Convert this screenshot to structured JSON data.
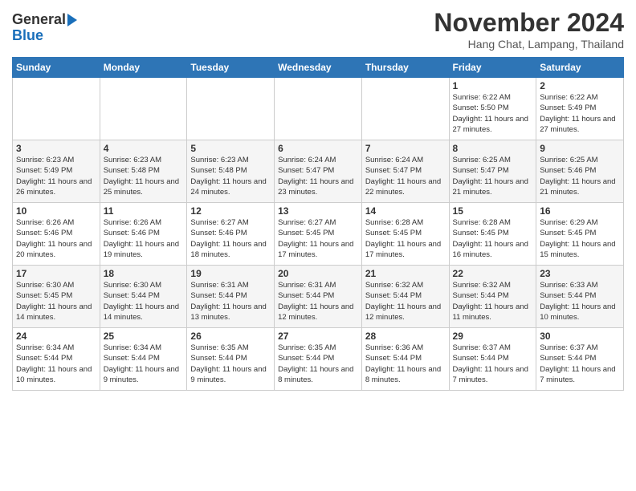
{
  "header": {
    "logo_general": "General",
    "logo_blue": "Blue",
    "title": "November 2024",
    "location": "Hang Chat, Lampang, Thailand"
  },
  "weekdays": [
    "Sunday",
    "Monday",
    "Tuesday",
    "Wednesday",
    "Thursday",
    "Friday",
    "Saturday"
  ],
  "weeks": [
    [
      {
        "day": "",
        "info": ""
      },
      {
        "day": "",
        "info": ""
      },
      {
        "day": "",
        "info": ""
      },
      {
        "day": "",
        "info": ""
      },
      {
        "day": "",
        "info": ""
      },
      {
        "day": "1",
        "info": "Sunrise: 6:22 AM\nSunset: 5:50 PM\nDaylight: 11 hours and 27 minutes."
      },
      {
        "day": "2",
        "info": "Sunrise: 6:22 AM\nSunset: 5:49 PM\nDaylight: 11 hours and 27 minutes."
      }
    ],
    [
      {
        "day": "3",
        "info": "Sunrise: 6:23 AM\nSunset: 5:49 PM\nDaylight: 11 hours and 26 minutes."
      },
      {
        "day": "4",
        "info": "Sunrise: 6:23 AM\nSunset: 5:48 PM\nDaylight: 11 hours and 25 minutes."
      },
      {
        "day": "5",
        "info": "Sunrise: 6:23 AM\nSunset: 5:48 PM\nDaylight: 11 hours and 24 minutes."
      },
      {
        "day": "6",
        "info": "Sunrise: 6:24 AM\nSunset: 5:47 PM\nDaylight: 11 hours and 23 minutes."
      },
      {
        "day": "7",
        "info": "Sunrise: 6:24 AM\nSunset: 5:47 PM\nDaylight: 11 hours and 22 minutes."
      },
      {
        "day": "8",
        "info": "Sunrise: 6:25 AM\nSunset: 5:47 PM\nDaylight: 11 hours and 21 minutes."
      },
      {
        "day": "9",
        "info": "Sunrise: 6:25 AM\nSunset: 5:46 PM\nDaylight: 11 hours and 21 minutes."
      }
    ],
    [
      {
        "day": "10",
        "info": "Sunrise: 6:26 AM\nSunset: 5:46 PM\nDaylight: 11 hours and 20 minutes."
      },
      {
        "day": "11",
        "info": "Sunrise: 6:26 AM\nSunset: 5:46 PM\nDaylight: 11 hours and 19 minutes."
      },
      {
        "day": "12",
        "info": "Sunrise: 6:27 AM\nSunset: 5:46 PM\nDaylight: 11 hours and 18 minutes."
      },
      {
        "day": "13",
        "info": "Sunrise: 6:27 AM\nSunset: 5:45 PM\nDaylight: 11 hours and 17 minutes."
      },
      {
        "day": "14",
        "info": "Sunrise: 6:28 AM\nSunset: 5:45 PM\nDaylight: 11 hours and 17 minutes."
      },
      {
        "day": "15",
        "info": "Sunrise: 6:28 AM\nSunset: 5:45 PM\nDaylight: 11 hours and 16 minutes."
      },
      {
        "day": "16",
        "info": "Sunrise: 6:29 AM\nSunset: 5:45 PM\nDaylight: 11 hours and 15 minutes."
      }
    ],
    [
      {
        "day": "17",
        "info": "Sunrise: 6:30 AM\nSunset: 5:45 PM\nDaylight: 11 hours and 14 minutes."
      },
      {
        "day": "18",
        "info": "Sunrise: 6:30 AM\nSunset: 5:44 PM\nDaylight: 11 hours and 14 minutes."
      },
      {
        "day": "19",
        "info": "Sunrise: 6:31 AM\nSunset: 5:44 PM\nDaylight: 11 hours and 13 minutes."
      },
      {
        "day": "20",
        "info": "Sunrise: 6:31 AM\nSunset: 5:44 PM\nDaylight: 11 hours and 12 minutes."
      },
      {
        "day": "21",
        "info": "Sunrise: 6:32 AM\nSunset: 5:44 PM\nDaylight: 11 hours and 12 minutes."
      },
      {
        "day": "22",
        "info": "Sunrise: 6:32 AM\nSunset: 5:44 PM\nDaylight: 11 hours and 11 minutes."
      },
      {
        "day": "23",
        "info": "Sunrise: 6:33 AM\nSunset: 5:44 PM\nDaylight: 11 hours and 10 minutes."
      }
    ],
    [
      {
        "day": "24",
        "info": "Sunrise: 6:34 AM\nSunset: 5:44 PM\nDaylight: 11 hours and 10 minutes."
      },
      {
        "day": "25",
        "info": "Sunrise: 6:34 AM\nSunset: 5:44 PM\nDaylight: 11 hours and 9 minutes."
      },
      {
        "day": "26",
        "info": "Sunrise: 6:35 AM\nSunset: 5:44 PM\nDaylight: 11 hours and 9 minutes."
      },
      {
        "day": "27",
        "info": "Sunrise: 6:35 AM\nSunset: 5:44 PM\nDaylight: 11 hours and 8 minutes."
      },
      {
        "day": "28",
        "info": "Sunrise: 6:36 AM\nSunset: 5:44 PM\nDaylight: 11 hours and 8 minutes."
      },
      {
        "day": "29",
        "info": "Sunrise: 6:37 AM\nSunset: 5:44 PM\nDaylight: 11 hours and 7 minutes."
      },
      {
        "day": "30",
        "info": "Sunrise: 6:37 AM\nSunset: 5:44 PM\nDaylight: 11 hours and 7 minutes."
      }
    ]
  ]
}
